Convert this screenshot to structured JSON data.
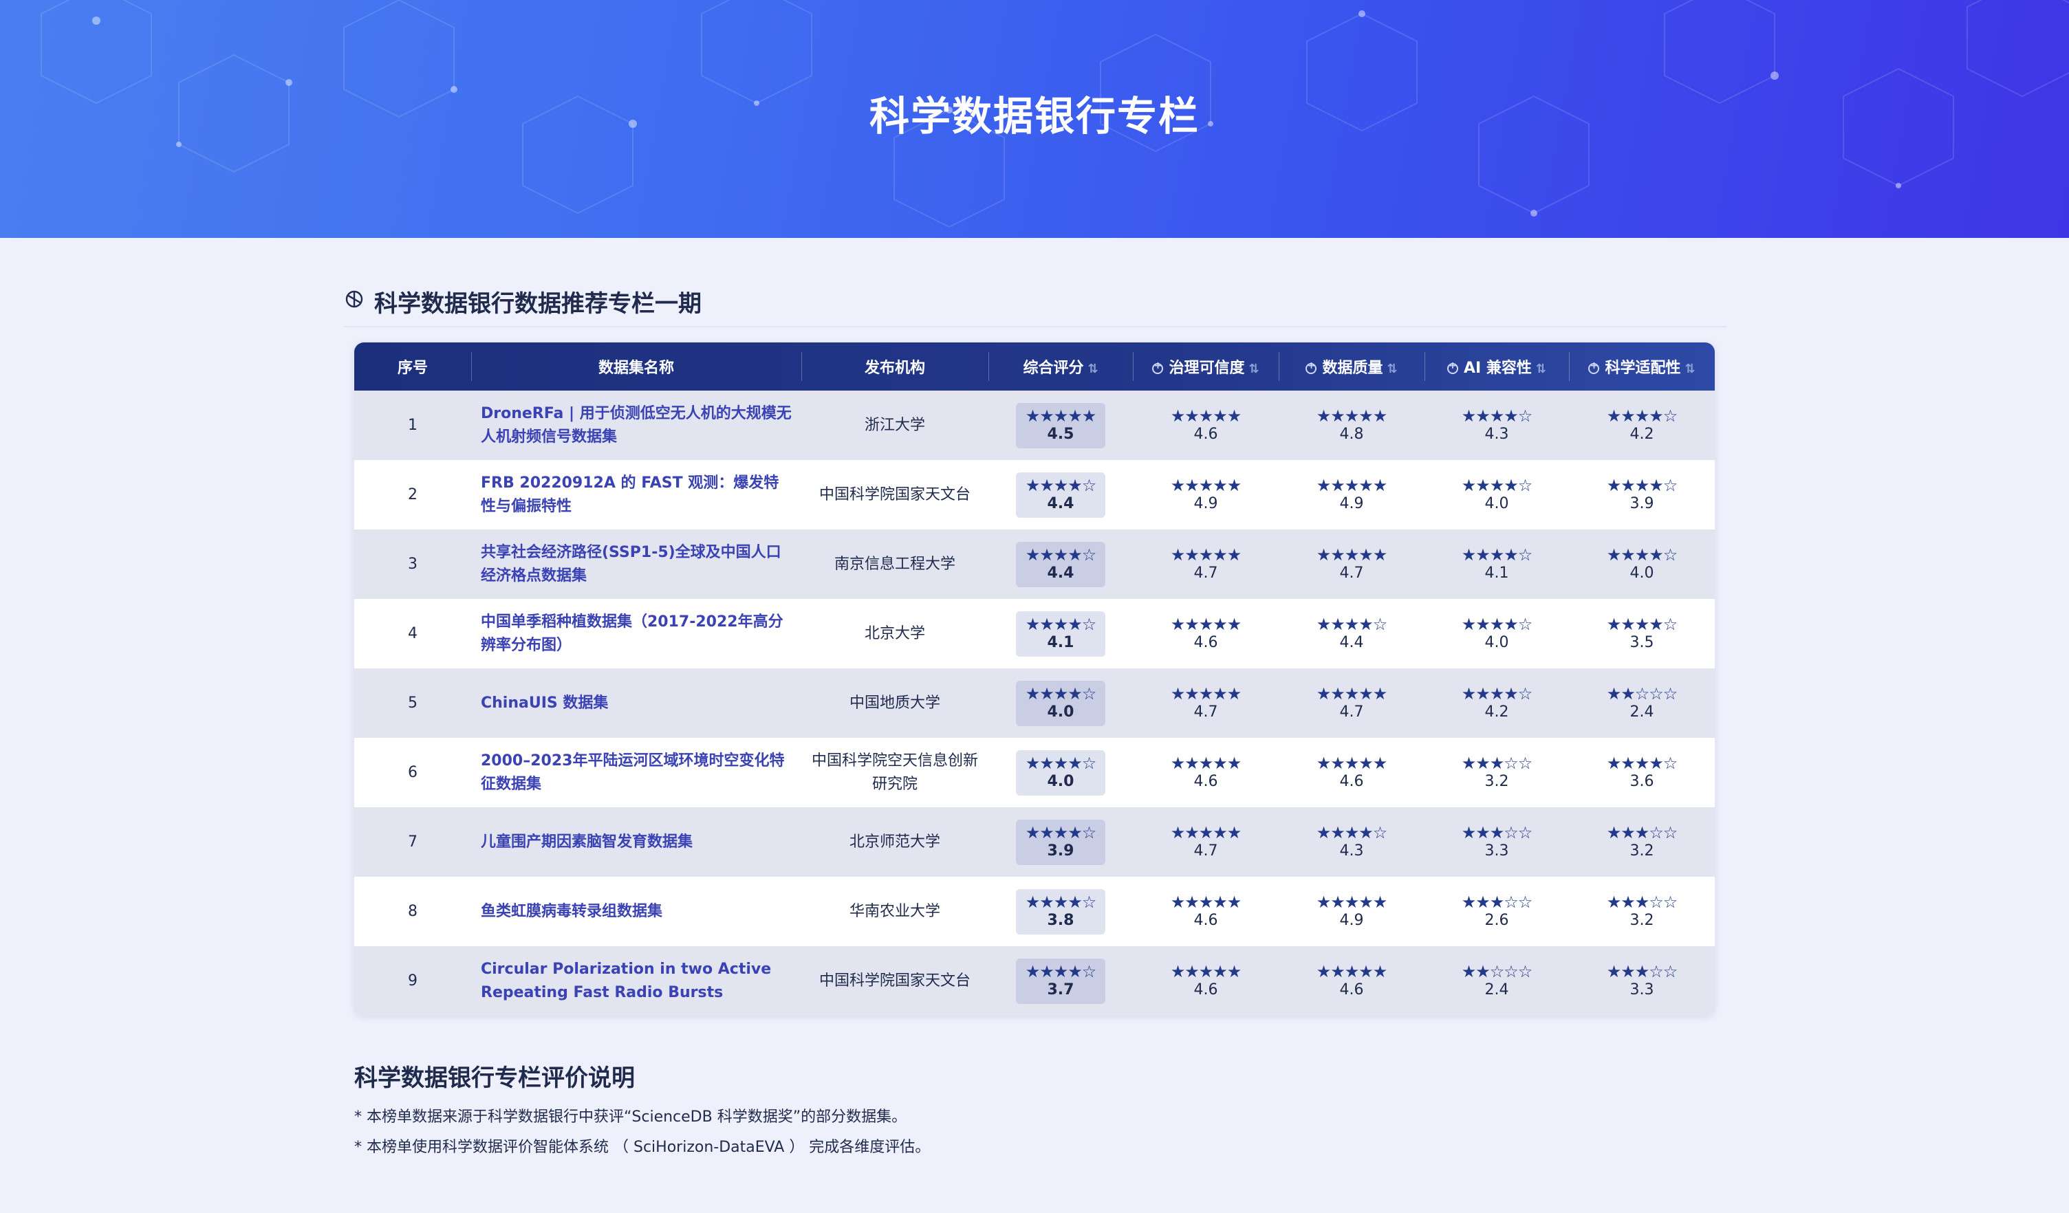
{
  "banner": {
    "title": "科学数据银行专栏"
  },
  "section": {
    "title": "科学数据银行数据推荐专栏一期"
  },
  "table": {
    "headers": {
      "index": "序号",
      "name": "数据集名称",
      "org": "发布机构",
      "overall": "综合评分",
      "governance": "治理可信度",
      "quality": "数据质量",
      "ai": "AI 兼容性",
      "science": "科学适配性"
    },
    "rows": [
      {
        "index": "1",
        "name": "DroneRFa | 用于侦测低空无人机的大规模无人机射频信号数据集",
        "org": "浙江大学",
        "overall": "4.5",
        "governance": "4.6",
        "quality": "4.8",
        "ai": "4.3",
        "science": "4.2"
      },
      {
        "index": "2",
        "name": "FRB 20220912A 的 FAST 观测：爆发特性与偏振特性",
        "org": "中国科学院国家天文台",
        "overall": "4.4",
        "governance": "4.9",
        "quality": "4.9",
        "ai": "4.0",
        "science": "3.9"
      },
      {
        "index": "3",
        "name": "共享社会经济路径(SSP1-5)全球及中国人口经济格点数据集",
        "org": "南京信息工程大学",
        "overall": "4.4",
        "governance": "4.7",
        "quality": "4.7",
        "ai": "4.1",
        "science": "4.0"
      },
      {
        "index": "4",
        "name": "中国单季稻种植数据集（2017-2022年高分辨率分布图）",
        "org": "北京大学",
        "overall": "4.1",
        "governance": "4.6",
        "quality": "4.4",
        "ai": "4.0",
        "science": "3.5"
      },
      {
        "index": "5",
        "name": "ChinaUIS 数据集",
        "org": "中国地质大学",
        "overall": "4.0",
        "governance": "4.7",
        "quality": "4.7",
        "ai": "4.2",
        "science": "2.4"
      },
      {
        "index": "6",
        "name": "2000–2023年平陆运河区域环境时空变化特征数据集",
        "org": "中国科学院空天信息创新研究院",
        "overall": "4.0",
        "governance": "4.6",
        "quality": "4.6",
        "ai": "3.2",
        "science": "3.6"
      },
      {
        "index": "7",
        "name": "儿童围产期因素脑智发育数据集",
        "org": "北京师范大学",
        "overall": "3.9",
        "governance": "4.7",
        "quality": "4.3",
        "ai": "3.3",
        "science": "3.2"
      },
      {
        "index": "8",
        "name": "鱼类虹膜病毒转录组数据集",
        "org": "华南农业大学",
        "overall": "3.8",
        "governance": "4.6",
        "quality": "4.9",
        "ai": "2.6",
        "science": "3.2"
      },
      {
        "index": "9",
        "name": "Circular Polarization in two Active Repeating Fast Radio Bursts",
        "org": "中国科学院国家天文台",
        "overall": "3.7",
        "governance": "4.6",
        "quality": "4.6",
        "ai": "2.4",
        "science": "3.3"
      }
    ]
  },
  "notes": {
    "title": "科学数据银行专栏评价说明",
    "lines": [
      "* 本榜单数据来源于科学数据银行中获评“ScienceDB 科学数据奖”的部分数据集。",
      "* 本榜单使用科学数据评价智能体系统 （ SciHorizon-DataEVA ） 完成各维度评估。"
    ]
  },
  "icons": {
    "section": "openai-logo-icon",
    "sort": "sort-icon",
    "metric": "plus-circle-icon",
    "star_full": "star-icon",
    "star_empty": "star-outline-icon"
  },
  "colors": {
    "banner_start": "#4a7ef0",
    "banner_end": "#3f35e6",
    "header_bg": "#1c2f7c",
    "link": "#3a42b4",
    "star": "#233a8b",
    "page_bg": "#eef0fb"
  }
}
